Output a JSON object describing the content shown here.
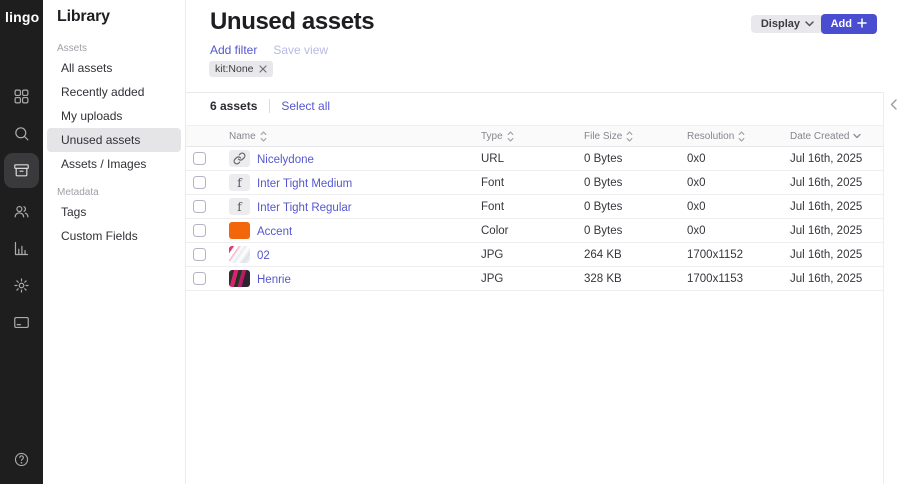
{
  "brand": {
    "logo": "lingo"
  },
  "rail": {
    "icons": [
      "apps-grid-icon",
      "search-icon",
      "assets-archive-icon",
      "members-icon",
      "insights-chart-icon",
      "settings-gear-icon",
      "billing-card-icon",
      "help-icon"
    ],
    "selected": "assets-archive-icon"
  },
  "sidebar": {
    "title": "Library",
    "sections": [
      {
        "label": "Assets",
        "items": [
          {
            "label": "All assets",
            "selected": false
          },
          {
            "label": "Recently added",
            "selected": false
          },
          {
            "label": "My uploads",
            "selected": false
          },
          {
            "label": "Unused assets",
            "selected": true
          },
          {
            "label": "Assets / Images",
            "selected": false
          }
        ]
      },
      {
        "label": "Metadata",
        "items": [
          {
            "label": "Tags",
            "selected": false
          },
          {
            "label": "Custom Fields",
            "selected": false
          }
        ]
      }
    ]
  },
  "header": {
    "title": "Unused assets",
    "display_button": "Display",
    "add_button": "Add",
    "add_filter": "Add filter",
    "save_view": "Save view",
    "filter_chip": "kit:None"
  },
  "toolbar": {
    "count": "6 assets",
    "select_all": "Select all"
  },
  "table": {
    "columns": [
      {
        "label": "Name",
        "sort": "both"
      },
      {
        "label": "Type",
        "sort": "both"
      },
      {
        "label": "File Size",
        "sort": "both"
      },
      {
        "label": "Resolution",
        "sort": "both"
      },
      {
        "label": "Date Created",
        "sort": "desc"
      }
    ],
    "rows": [
      {
        "icon": "link",
        "name": "Nicelydone",
        "type": "URL",
        "size": "0 Bytes",
        "resolution": "0x0",
        "date": "Jul 16th, 2025"
      },
      {
        "icon": "font",
        "name": "Inter Tight Medium",
        "type": "Font",
        "size": "0 Bytes",
        "resolution": "0x0",
        "date": "Jul 16th, 2025"
      },
      {
        "icon": "font",
        "name": "Inter Tight Regular",
        "type": "Font",
        "size": "0 Bytes",
        "resolution": "0x0",
        "date": "Jul 16th, 2025"
      },
      {
        "icon": "color",
        "name": "Accent",
        "type": "Color",
        "size": "0 Bytes",
        "resolution": "0x0",
        "date": "Jul 16th, 2025"
      },
      {
        "icon": "image-02",
        "name": "02",
        "type": "JPG",
        "size": "264 KB",
        "resolution": "1700x1152",
        "date": "Jul 16th, 2025"
      },
      {
        "icon": "image-henrie",
        "name": "Henrie",
        "type": "JPG",
        "size": "328 KB",
        "resolution": "1700x1153",
        "date": "Jul 16th, 2025"
      }
    ]
  },
  "icons": {
    "font_glyph": "f"
  },
  "colors": {
    "accent": "#4B4DD1",
    "link": "#5557CF",
    "swatch_orange": "#F2670B"
  }
}
